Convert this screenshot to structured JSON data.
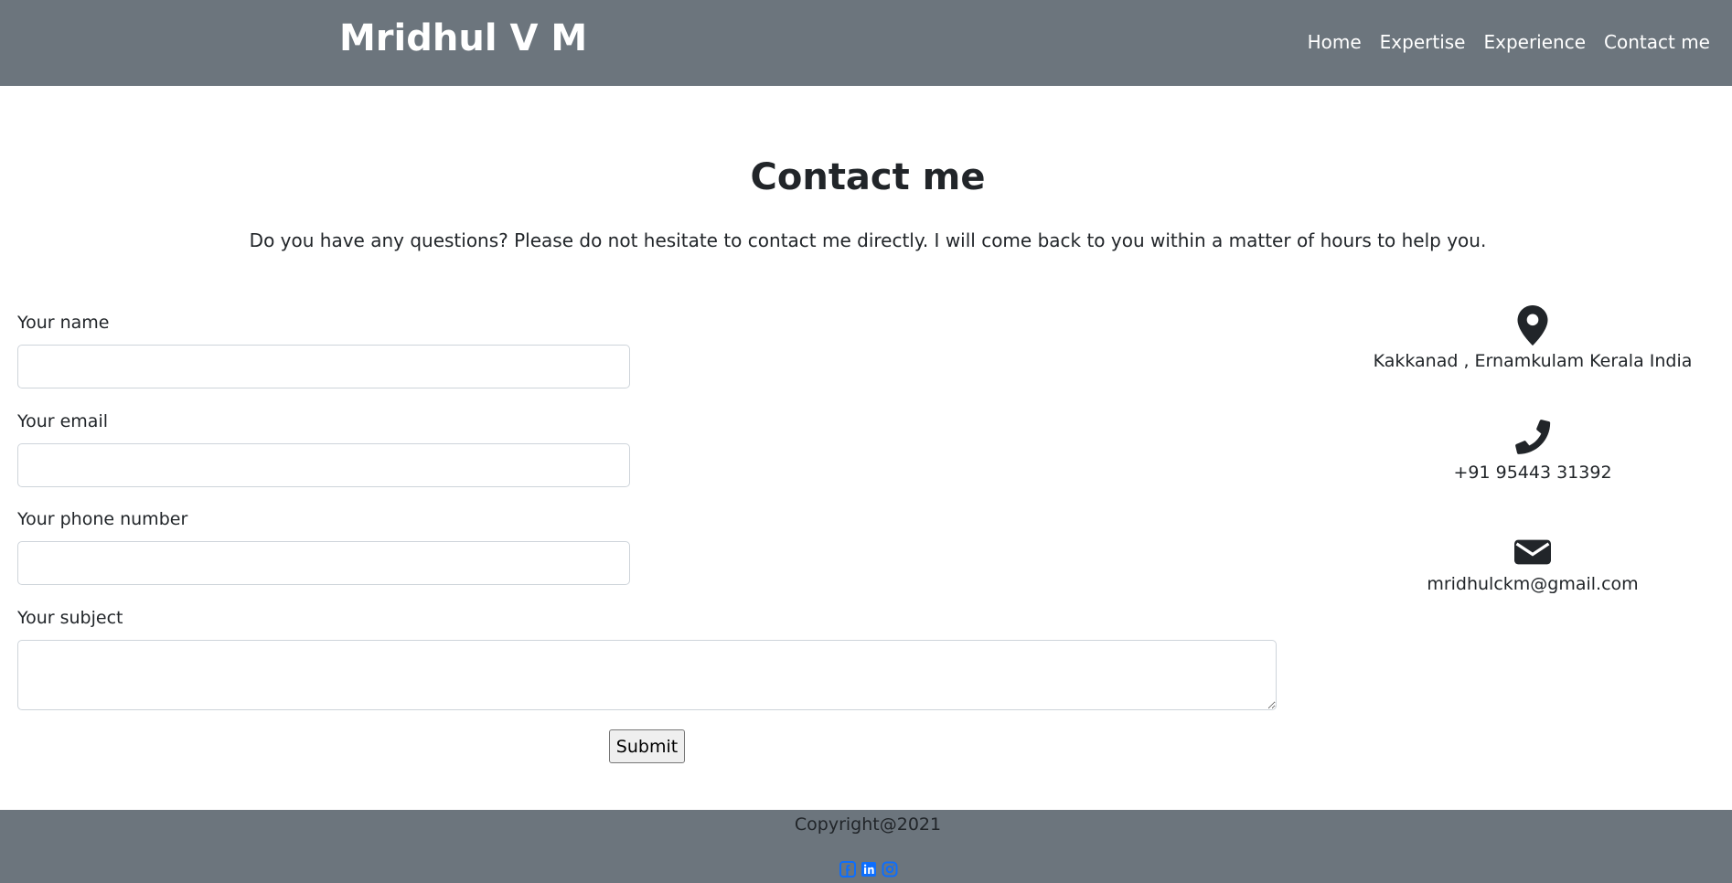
{
  "header": {
    "brand": "Mridhul V M",
    "nav": [
      "Home",
      "Expertise",
      "Experience",
      "Contact me"
    ]
  },
  "main": {
    "title": "Contact me",
    "intro": "Do you have any questions? Please do not hesitate to contact me directly. I will come back to you within a matter of hours to help you."
  },
  "form": {
    "name_label": "Your name",
    "name_value": "",
    "email_label": "Your email",
    "email_value": "",
    "phone_label": "Your phone number",
    "phone_value": "",
    "subject_label": "Your subject",
    "subject_value": "",
    "submit_label": "Submit"
  },
  "contact_info": {
    "address": "Kakkanad , Ernamkulam Kerala India",
    "phone": "+91 95443 31392",
    "email": "mridhulckm@gmail.com",
    "icons": [
      "map-marker-icon",
      "phone-icon",
      "envelope-icon"
    ]
  },
  "footer": {
    "copyright": "Copyright@2021",
    "social_icons": [
      "facebook-icon",
      "linkedin-icon",
      "instagram-icon"
    ],
    "social_color": "#0d6efd"
  },
  "colors": {
    "navbar_bg": "#6c757d",
    "text": "#212529"
  }
}
